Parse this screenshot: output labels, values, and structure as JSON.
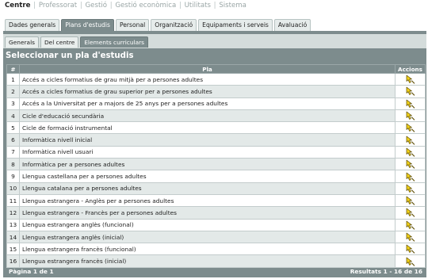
{
  "topnav": {
    "items": [
      "Centre",
      "Professorat",
      "Gestió",
      "Gestió econòmica",
      "Utilitats",
      "Sistema"
    ],
    "separator": "|"
  },
  "tabs": [
    "Dades generals",
    "Plans d'estudis",
    "Personal",
    "Organització",
    "Equipaments i serveis",
    "Avaluació"
  ],
  "subtabs": [
    "Generals",
    "Del centre",
    "Elements curriculars"
  ],
  "panel": {
    "title": "Seleccionar un pla d'estudis",
    "columns": {
      "num": "#",
      "pla": "Pla",
      "actions": "Accions"
    }
  },
  "rows": [
    {
      "num": "1",
      "pla": "Accés a cicles formatius de grau mitjà per a persones adultes"
    },
    {
      "num": "2",
      "pla": "Accés a cicles formatius de grau superior per a persones adultes"
    },
    {
      "num": "3",
      "pla": "Accés a la Universitat per a majors de 25 anys per a persones adultes"
    },
    {
      "num": "4",
      "pla": "Cicle d'educació secundària"
    },
    {
      "num": "5",
      "pla": "Cicle de formació instrumental"
    },
    {
      "num": "6",
      "pla": "Informàtica nivell inicial"
    },
    {
      "num": "7",
      "pla": "Informàtica nivell usuari"
    },
    {
      "num": "8",
      "pla": "Informàtica per a persones adultes"
    },
    {
      "num": "9",
      "pla": "Llengua castellana per a persones adultes"
    },
    {
      "num": "10",
      "pla": "Llengua catalana per a persones adultes"
    },
    {
      "num": "11",
      "pla": "Llengua estrangera - Anglès per a persones adultes"
    },
    {
      "num": "12",
      "pla": "Llengua estrangera - Francès per a persones adultes"
    },
    {
      "num": "13",
      "pla": "Llengua estrangera anglès (funcional)"
    },
    {
      "num": "14",
      "pla": "Llengua estrangera anglès (inicial)"
    },
    {
      "num": "15",
      "pla": "Llengua estrangera francès (funcional)"
    },
    {
      "num": "16",
      "pla": "Llengua estrangera francès (inicial)"
    }
  ],
  "footer": {
    "page": "Pàgina 1 de 1",
    "results": "Resultats 1 - 16 de 16"
  },
  "colors": {
    "panel": "#7d8c8d",
    "row_alt": "#e3e9e8",
    "select_icon": "#f2d21b"
  },
  "icons": {
    "select_action": "pointer-select-icon"
  }
}
